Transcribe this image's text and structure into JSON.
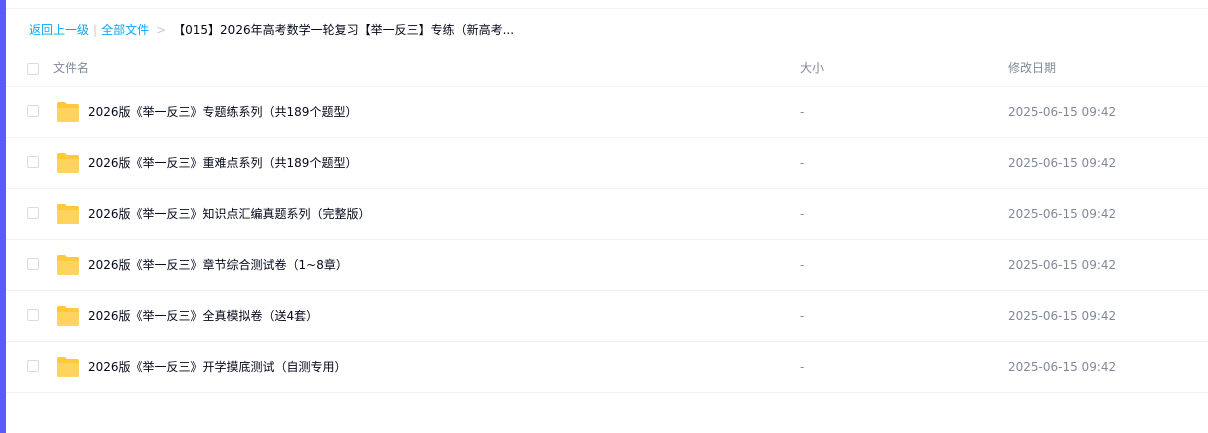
{
  "breadcrumb": {
    "back": "返回上一级",
    "separator": "|",
    "all_files": "全部文件",
    "arrow": ">",
    "current": "【015】2026年高考数学一轮复习【举一反三】专练（新高考..."
  },
  "table": {
    "headers": {
      "name": "文件名",
      "size": "大小",
      "modified": "修改日期"
    },
    "rows": [
      {
        "name": "2026版《举一反三》专题练系列（共189个题型）",
        "size": "-",
        "modified": "2025-06-15 09:42"
      },
      {
        "name": "2026版《举一反三》重难点系列（共189个题型）",
        "size": "-",
        "modified": "2025-06-15 09:42"
      },
      {
        "name": "2026版《举一反三》知识点汇编真题系列（完整版）",
        "size": "-",
        "modified": "2025-06-15 09:42"
      },
      {
        "name": "2026版《举一反三》章节综合测试卷（1~8章）",
        "size": "-",
        "modified": "2025-06-15 09:42"
      },
      {
        "name": "2026版《举一反三》全真模拟卷（送4套）",
        "size": "-",
        "modified": "2025-06-15 09:42"
      },
      {
        "name": "2026版《举一反三》开学摸底测试（自测专用）",
        "size": "-",
        "modified": "2025-06-15 09:42"
      }
    ]
  },
  "colors": {
    "link": "#06a7ff",
    "accent": "#5b5bff",
    "folder": "#ffc83d"
  },
  "icons": {
    "folder": "folder-icon"
  }
}
